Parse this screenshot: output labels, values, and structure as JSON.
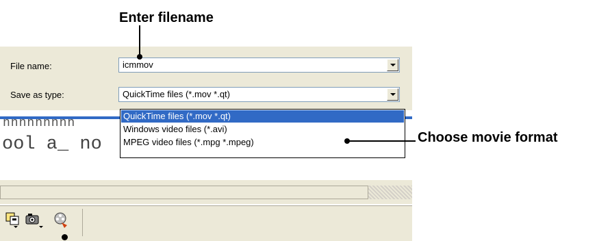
{
  "callouts": {
    "enter_filename": "Enter filename",
    "choose_format": "Choose movie format"
  },
  "dialog": {
    "file_name_label": "File name:",
    "file_name_value": "icmmov",
    "save_as_type_label": "Save as type:",
    "save_as_type_value": "QuickTime files (*.mov *.qt)",
    "options": [
      "QuickTime files (*.mov *.qt)",
      "Windows video files (*.avi)",
      "MPEG video files (*.mpg *.mpeg)"
    ],
    "selected_index": 0
  },
  "background": {
    "code_line_1": "nnnnnnnnn",
    "code_line_2": "ool a_ no"
  },
  "toolbar": {
    "icons": [
      "save-frame-icon",
      "camera-dropdown-icon",
      "movie-reel-icon"
    ]
  },
  "colors": {
    "selection": "#316ac5",
    "panel": "#ece9d8"
  }
}
